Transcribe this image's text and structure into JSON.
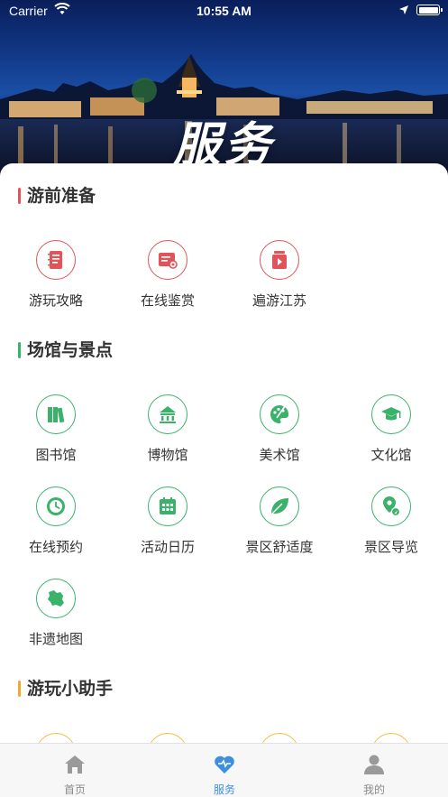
{
  "status_bar": {
    "carrier": "Carrier",
    "time": "10:55 AM"
  },
  "hero": {
    "title": "服务"
  },
  "sections": [
    {
      "title": "游前准备",
      "accent": "#e0555a",
      "items": [
        {
          "label": "游玩攻略",
          "icon": "notebook-icon"
        },
        {
          "label": "在线鉴赏",
          "icon": "appraisal-icon"
        },
        {
          "label": "遍游江苏",
          "icon": "video-play-icon"
        }
      ]
    },
    {
      "title": "场馆与景点",
      "accent": "#3ab26a",
      "items": [
        {
          "label": "图书馆",
          "icon": "books-icon"
        },
        {
          "label": "博物馆",
          "icon": "museum-icon"
        },
        {
          "label": "美术馆",
          "icon": "palette-icon"
        },
        {
          "label": "文化馆",
          "icon": "graduation-cap-icon"
        },
        {
          "label": "在线预约",
          "icon": "clock-icon"
        },
        {
          "label": "活动日历",
          "icon": "calendar-icon"
        },
        {
          "label": "景区舒适度",
          "icon": "leaf-icon"
        },
        {
          "label": "景区导览",
          "icon": "map-pin-icon"
        },
        {
          "label": "非遗地图",
          "icon": "province-map-icon"
        }
      ]
    },
    {
      "title": "游玩小助手",
      "accent": "#f0a830",
      "items": []
    }
  ],
  "tabbar": {
    "items": [
      {
        "label": "首页",
        "icon": "home-icon",
        "active": false
      },
      {
        "label": "服务",
        "icon": "heart-icon",
        "active": true
      },
      {
        "label": "我的",
        "icon": "user-icon",
        "active": false
      }
    ]
  },
  "colors": {
    "active_tab": "#3d8fe0",
    "red_accent": "#e0555a",
    "green_accent": "#3ab26a",
    "yellow_accent": "#f0c040"
  }
}
